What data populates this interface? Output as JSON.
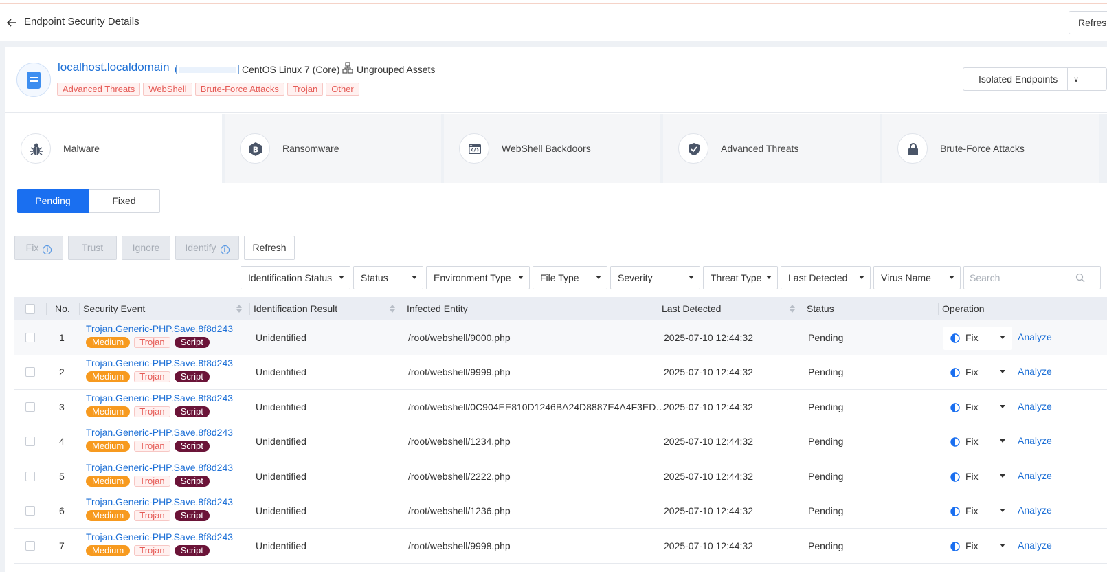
{
  "header": {
    "title": "Endpoint Security Details",
    "refresh_label": "Refresh"
  },
  "host": {
    "name": "localhost.localdomain",
    "ip_open": "(",
    "os": "CentOS Linux 7 (Core)",
    "group": "Ungrouped Assets",
    "tags": [
      "Advanced Threats",
      "WebShell",
      "Brute-Force Attacks",
      "Trojan",
      "Other"
    ],
    "isolate_label": "Isolated Endpoints",
    "isolate_chevron": "∨"
  },
  "categories": [
    {
      "label": "Malware",
      "icon": "bug-icon"
    },
    {
      "label": "Ransomware",
      "icon": "bitcoin-icon"
    },
    {
      "label": "WebShell Backdoors",
      "icon": "code-window-icon"
    },
    {
      "label": "Advanced Threats",
      "icon": "shield-check-icon"
    },
    {
      "label": "Brute-Force Attacks",
      "icon": "lock-icon"
    }
  ],
  "tabs": {
    "pending": "Pending",
    "fixed": "Fixed"
  },
  "actions": {
    "fix": "Fix",
    "trust": "Trust",
    "ignore": "Ignore",
    "identify": "Identify",
    "refresh": "Refresh",
    "info_glyph": "i"
  },
  "filters": [
    "Identification Status",
    "Status",
    "Environment Type",
    "File Type",
    "Severity",
    "Threat Type",
    "Last Detected",
    "Virus Name"
  ],
  "search": {
    "placeholder": "Search"
  },
  "table": {
    "columns": {
      "no": "No.",
      "event": "Security Event",
      "ident": "Identification Result",
      "entity": "Infected Entity",
      "last": "Last Detected",
      "status": "Status",
      "op": "Operation"
    },
    "fix_label": "Fix",
    "analyze_label": "Analyze",
    "rows": [
      {
        "no": "1",
        "event": "Trojan.Generic-PHP.Save.8f8d243",
        "severity": "Medium",
        "threat": "Trojan",
        "type": "Script",
        "ident": "Unidentified",
        "entity": "/root/webshell/9000.php",
        "last": "2025-07-10 12:44:32",
        "status": "Pending"
      },
      {
        "no": "2",
        "event": "Trojan.Generic-PHP.Save.8f8d243",
        "severity": "Medium",
        "threat": "Trojan",
        "type": "Script",
        "ident": "Unidentified",
        "entity": "/root/webshell/9999.php",
        "last": "2025-07-10 12:44:32",
        "status": "Pending"
      },
      {
        "no": "3",
        "event": "Trojan.Generic-PHP.Save.8f8d243",
        "severity": "Medium",
        "threat": "Trojan",
        "type": "Script",
        "ident": "Unidentified",
        "entity": "/root/webshell/0C904EE810D1246BA24D8887E4A4F3ED…",
        "last": "2025-07-10 12:44:32",
        "status": "Pending"
      },
      {
        "no": "4",
        "event": "Trojan.Generic-PHP.Save.8f8d243",
        "severity": "Medium",
        "threat": "Trojan",
        "type": "Script",
        "ident": "Unidentified",
        "entity": "/root/webshell/1234.php",
        "last": "2025-07-10 12:44:32",
        "status": "Pending"
      },
      {
        "no": "5",
        "event": "Trojan.Generic-PHP.Save.8f8d243",
        "severity": "Medium",
        "threat": "Trojan",
        "type": "Script",
        "ident": "Unidentified",
        "entity": "/root/webshell/2222.php",
        "last": "2025-07-10 12:44:32",
        "status": "Pending"
      },
      {
        "no": "6",
        "event": "Trojan.Generic-PHP.Save.8f8d243",
        "severity": "Medium",
        "threat": "Trojan",
        "type": "Script",
        "ident": "Unidentified",
        "entity": "/root/webshell/1236.php",
        "last": "2025-07-10 12:44:32",
        "status": "Pending"
      },
      {
        "no": "7",
        "event": "Trojan.Generic-PHP.Save.8f8d243",
        "severity": "Medium",
        "threat": "Trojan",
        "type": "Script",
        "ident": "Unidentified",
        "entity": "/root/webshell/9998.php",
        "last": "2025-07-10 12:44:32",
        "status": "Pending"
      }
    ]
  },
  "colors": {
    "accent": "#1a6ff0",
    "link": "#1c6fd6",
    "medium": "#f79a1f",
    "script": "#6b1438",
    "danger": "#e55a55"
  }
}
